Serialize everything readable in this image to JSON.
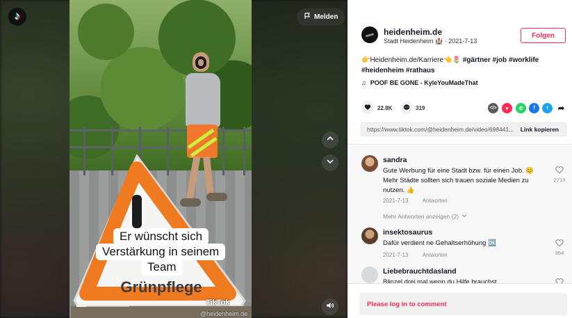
{
  "video": {
    "report_label": "Melden",
    "captions": [
      "Er wünscht sich",
      "Verstärkung in seinem",
      "Team"
    ],
    "sign_text": "Grünpflege",
    "watermark_brand": "TikTok",
    "watermark_handle": "@heidenheim.de",
    "progress": 0.18,
    "icons": {
      "logo": "tiktok-logo-icon",
      "report": "flag-icon",
      "nav_up": "chevron-up-icon",
      "nav_down": "chevron-down-icon",
      "volume": "volume-icon"
    }
  },
  "author": {
    "name": "heidenheim.de",
    "subtitle": "Stadt Heidenheim 🏰 · 2021-7-13",
    "follow_label": "Folgen"
  },
  "description": {
    "text": "👉Heidenheim.de/Karriere👈🌷 ",
    "hashtags": [
      "#gärtner",
      "#job",
      "#worklife",
      "#heidenheim",
      "#rathaus"
    ],
    "music_note": "♫",
    "music": "POOF BE GONE - KyleYouMadeThat"
  },
  "stats": {
    "likes": "22.8K",
    "comments": "319"
  },
  "share": {
    "icons": [
      "embed-icon",
      "tiktok-share-icon",
      "whatsapp-icon",
      "facebook-icon",
      "twitter-icon",
      "share-arrow-icon"
    ],
    "colors": [
      "#5b5b5b",
      "#fe2c55",
      "#25d366",
      "#1877f2",
      "#1da1f2",
      "#161823"
    ]
  },
  "link": {
    "url": "https://www.tiktok.com/@heidenheim.de/video/698441...",
    "copy_label": "Link kopieren"
  },
  "comments": [
    {
      "user": "sandra",
      "text": "Gute Werbung für eine Stadt bzw. für einen Job. 😊 Mehr Städte sollten sich trauen soziale Medien zu nutzen. 👍",
      "date": "2021-7-13",
      "reply_label": "Antworten",
      "likes": "2710"
    },
    {
      "user": "insektosaurus",
      "text": "Dafür verdient ne Gehaltserhöhung 🆗",
      "date": "2021-7-13",
      "reply_label": "Antworten",
      "likes": "364"
    },
    {
      "user": "Liebebrauchtdasland",
      "text": "Blinzel drei mal wenn du Hilfe brauchst",
      "date": "",
      "reply_label": "",
      "likes": ""
    }
  ],
  "more_replies_label": "Mehr Antworten anzeigen (2)",
  "login": {
    "prompt": "Please log in to comment"
  },
  "colors": {
    "accent": "#fe2c55",
    "text": "#161823",
    "muted": "#8a8b91"
  }
}
